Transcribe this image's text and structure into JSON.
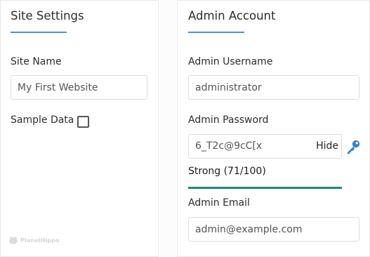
{
  "site_settings": {
    "title": "Site Settings",
    "site_name_label": "Site Name",
    "site_name_value": "My First Website",
    "sample_data_label": "Sample Data",
    "sample_data_checked": false
  },
  "admin_account": {
    "title": "Admin Account",
    "username_label": "Admin Username",
    "username_value": "administrator",
    "password_label": "Admin Password",
    "password_value": "6_T2c@9cC[x",
    "password_toggle_label": "Hide",
    "generate_icon": "key-icon",
    "strength_label": "Strong (71/100)",
    "strength_score": 0.71,
    "email_label": "Admin Email",
    "email_value": "admin@example.com"
  },
  "branding": {
    "logo_text": "PlanetHippo"
  },
  "colors": {
    "accent": "#4a8fe0",
    "strength": "#1a8a7a",
    "key_icon": "#2f86d6"
  }
}
